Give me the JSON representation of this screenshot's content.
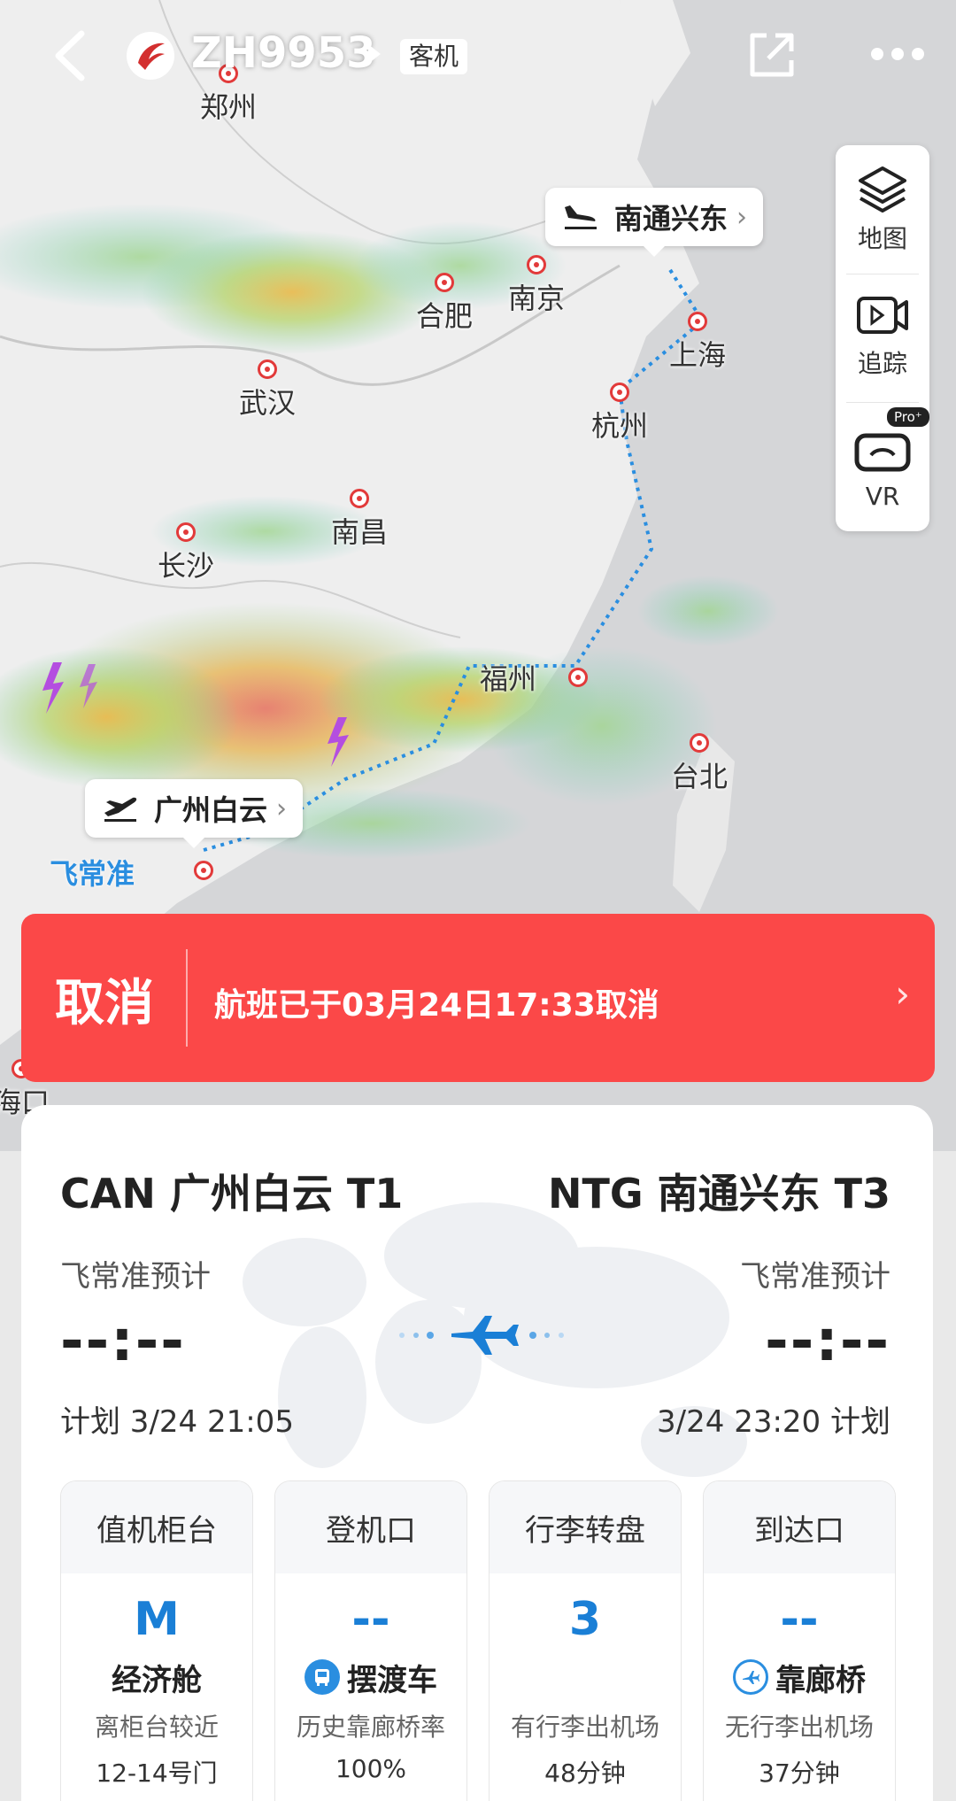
{
  "header": {
    "flight_number": "ZH9953",
    "aircraft_type": "客机"
  },
  "map": {
    "cities": [
      {
        "name": "郑州"
      },
      {
        "name": "南京"
      },
      {
        "name": "合肥"
      },
      {
        "name": "上海"
      },
      {
        "name": "武汉"
      },
      {
        "name": "杭州"
      },
      {
        "name": "南昌"
      },
      {
        "name": "长沙"
      },
      {
        "name": "福州"
      },
      {
        "name": "台北"
      },
      {
        "name": "海口"
      }
    ],
    "arrival_callout": "南通兴东",
    "departure_callout": "广州白云",
    "fcz_label": "飞常准"
  },
  "side_panel": {
    "map_label": "地图",
    "track_label": "追踪",
    "vr_label": "VR",
    "pro_badge": "Pro⁺"
  },
  "banner": {
    "status": "取消",
    "message": "航班已于03月24日17:33取消",
    "color": "#fb4848"
  },
  "card": {
    "departure": {
      "title": "CAN 广州白云 T1",
      "estimate_label": "飞常准预计",
      "estimate_time": "--:--",
      "plan": "计划 3/24 21:05"
    },
    "arrival": {
      "title": "NTG 南通兴东 T3",
      "estimate_label": "飞常准预计",
      "estimate_time": "--:--",
      "plan": "3/24 23:20 计划"
    },
    "tiles": [
      {
        "head": "值机柜台",
        "value": "M",
        "sub": "经济舱",
        "note1": "离柜台较近",
        "note2": "12-14号门"
      },
      {
        "head": "登机口",
        "value": "--",
        "sub": "摆渡车",
        "note1": "历史靠廊桥率",
        "note2": "100%"
      },
      {
        "head": "行李转盘",
        "value": "3",
        "sub": "",
        "note1": "有行李出机场",
        "note2": "48分钟"
      },
      {
        "head": "到达口",
        "value": "--",
        "sub": "靠廊桥",
        "note1": "无行李出机场",
        "note2": "37分钟"
      }
    ]
  }
}
